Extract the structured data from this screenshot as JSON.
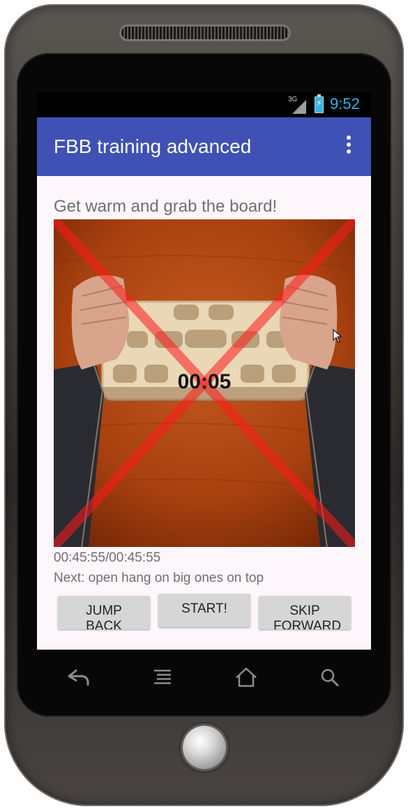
{
  "status_bar": {
    "network_label": "3G",
    "time": "9:52",
    "battery_icon": "battery-charging-icon"
  },
  "action_bar": {
    "title": "FBB training advanced",
    "overflow_icon": "more-vert-icon",
    "color": "#3f51b5"
  },
  "main": {
    "instruction": "Get warm and grab the board!",
    "timer": "00:05",
    "elapsed": "00:45:55/00:45:55",
    "next": "Next: open hang on big ones on top"
  },
  "buttons": {
    "jump_back": "JUMP BACK",
    "start": "START!",
    "skip_forward": "SKIP FORWARD"
  },
  "nav_bar": {
    "back_icon": "back-arrow-icon",
    "menu_icon": "menu-icon",
    "home_icon": "home-icon",
    "search_icon": "search-icon"
  }
}
